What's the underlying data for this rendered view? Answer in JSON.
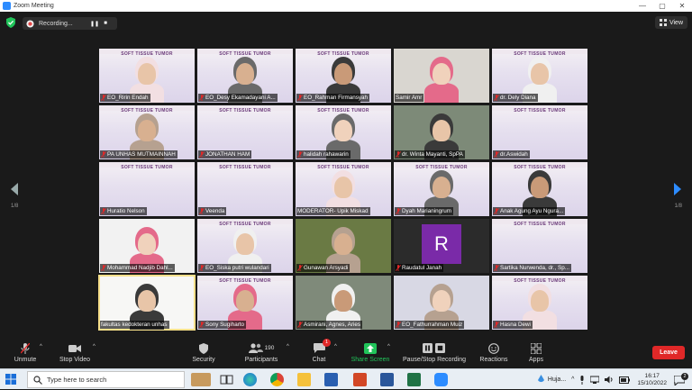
{
  "window": {
    "title": "Zoom Meeting",
    "controls": [
      "—",
      "▢",
      "✕"
    ]
  },
  "topbar": {
    "recording_label": "Recording...",
    "pause_symbol": "❚❚",
    "stop_symbol": "■",
    "view_label": "View"
  },
  "colors": {
    "accent": "#2d8cff",
    "leave": "#e02828",
    "mic_muted": "#e02828",
    "tile_bg": "#d8d4ea",
    "slide_title": "#6a3a7a"
  },
  "slide_title": "SOFT TISSUE TUMOR",
  "tiles": [
    {
      "name": "EO_Ririn Endah",
      "muted": true
    },
    {
      "name": "EO_Desy Ekamadayani A...",
      "muted": true
    },
    {
      "name": "EO_Rahman Firmansyah",
      "muted": true
    },
    {
      "name": "Samir Amr",
      "muted": false
    },
    {
      "name": "dr. Dely Diana",
      "muted": true
    },
    {
      "name": "PA UNHAS MUTMAINNAH",
      "muted": true
    },
    {
      "name": "JONATHAN HAM",
      "muted": true
    },
    {
      "name": "halidah rahawarin",
      "muted": true
    },
    {
      "name": "dr. Winta Mayanti, SpPA",
      "muted": true
    },
    {
      "name": "dr.Aswidah",
      "muted": true
    },
    {
      "name": "Huratio Nelson",
      "muted": true
    },
    {
      "name": "Veenda",
      "muted": true
    },
    {
      "name": "MODERATOR- Upik Miskad",
      "muted": false
    },
    {
      "name": "Dyah Marianingrum",
      "muted": true
    },
    {
      "name": "Anak Agung Ayu Ngura...",
      "muted": true
    },
    {
      "name": "Mohammad Nadjib Dahl...",
      "muted": true
    },
    {
      "name": "EO_Siska putri wulandari",
      "muted": true
    },
    {
      "name": "Gunawan Arsyadi",
      "muted": true
    },
    {
      "name": "Raudatul Janah",
      "muted": true
    },
    {
      "name": "Sartika Nurwenda, dr., Sp...",
      "muted": true
    },
    {
      "name": "fakultas kedokteran unhas",
      "muted": false
    },
    {
      "name": "Sony Sugiharto",
      "muted": true
    },
    {
      "name": "Asmirani, Agnes, Aries",
      "muted": true
    },
    {
      "name": "EO_Fathurrahman Muiz",
      "muted": true
    },
    {
      "name": "Hasna Dewi",
      "muted": true
    }
  ],
  "avatar_letter": "R",
  "avatar_color": "#7a2aa8",
  "pagination": {
    "left": "1/8",
    "right": "1/8"
  },
  "toolbar": {
    "unmute": "Unmute",
    "stop_video": "Stop Video",
    "security": "Security",
    "participants": "Participants",
    "participants_count": "190",
    "chat": "Chat",
    "chat_badge": "1",
    "share_screen": "Share Screen",
    "record": "Pause/Stop Recording",
    "reactions": "Reactions",
    "apps": "Apps",
    "leave": "Leave"
  },
  "taskbar": {
    "search_placeholder": "Type here to search",
    "weather": "Huja...",
    "time": "16:17",
    "date": "15/10/2022",
    "notif_count": "2"
  }
}
